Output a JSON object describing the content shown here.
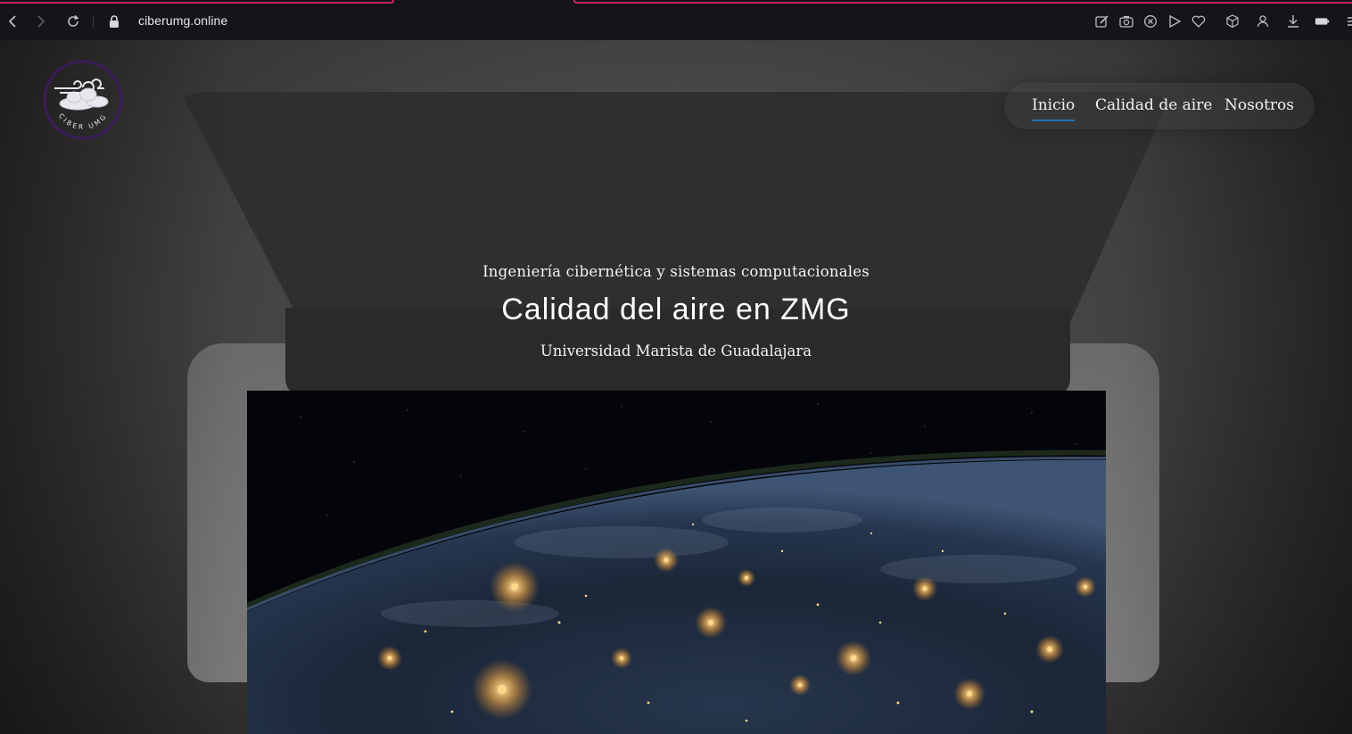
{
  "browser": {
    "url": "ciberumg.online",
    "icons": [
      "back-icon",
      "forward-icon",
      "reload-icon",
      "lock-icon",
      "edit-icon",
      "camera-icon",
      "close-circle-icon",
      "send-icon",
      "heart-icon",
      "cube-icon",
      "user-icon",
      "download-icon",
      "battery-icon",
      "menu-icon"
    ],
    "accent": "#c4265b"
  },
  "site": {
    "logo_text": "CIBER UMG",
    "nav": [
      {
        "label": "Inicio",
        "active": true
      },
      {
        "label": "Calidad de aire",
        "active": false
      },
      {
        "label": "Nosotros",
        "active": false
      }
    ],
    "nav_active_color": "#1f6fb2",
    "hero": {
      "subtitle": "Ingeniería cibernética y sistemas computacionales",
      "title": "Calidad del aire en ZMG",
      "university": "Universidad Marista de Guadalajara"
    },
    "logo_color": "#3b1c5a"
  }
}
